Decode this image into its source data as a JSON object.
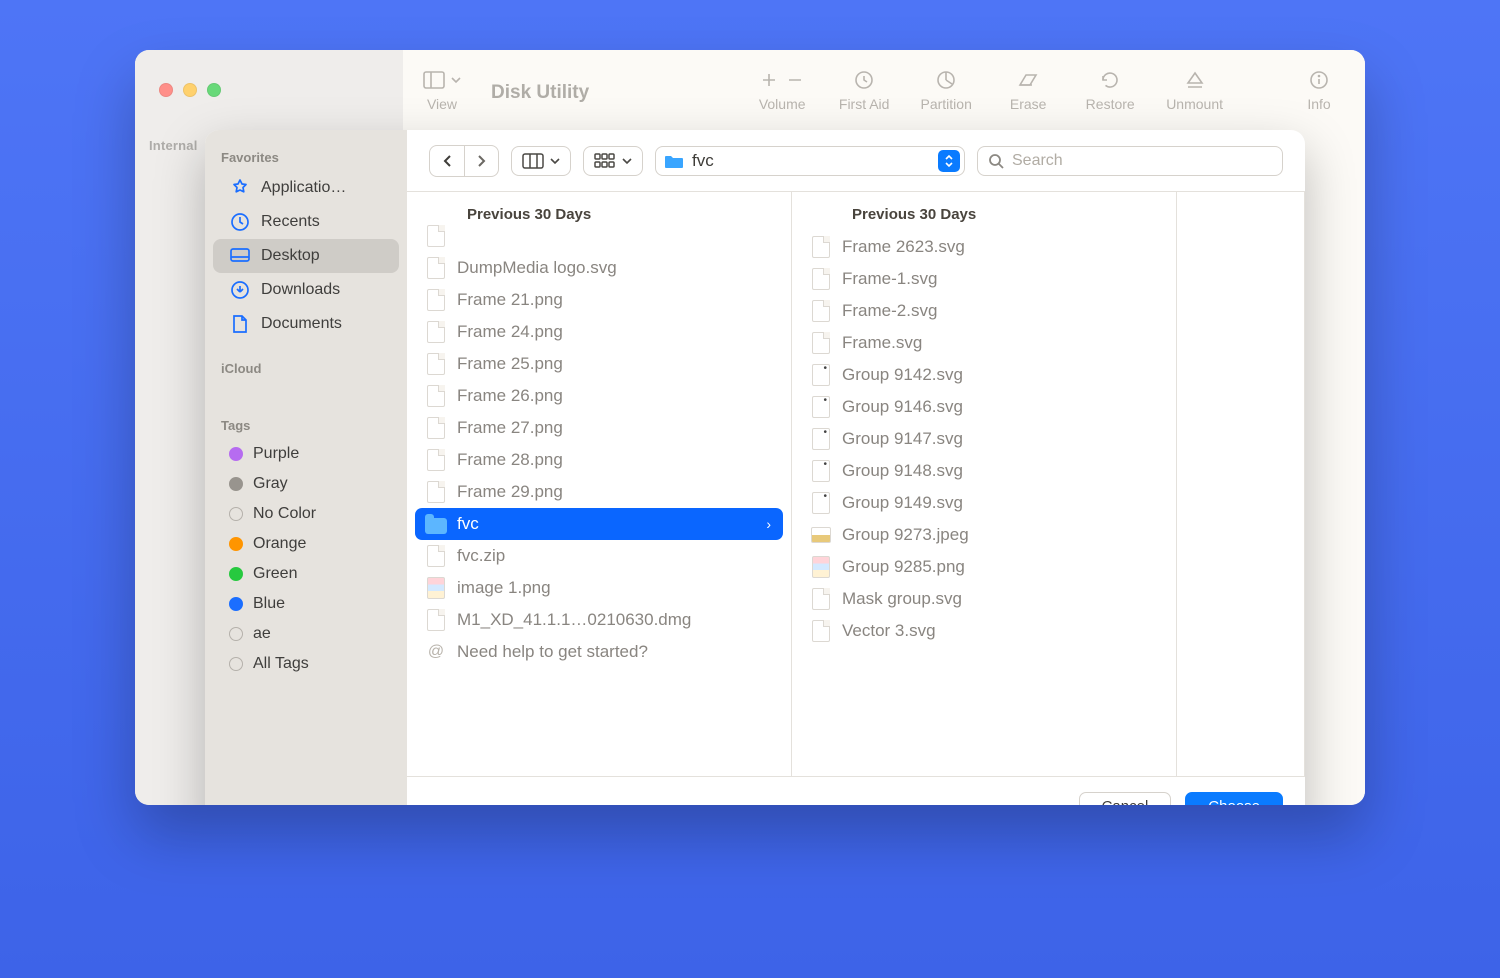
{
  "app": {
    "title": "Disk Utility",
    "toolbar": {
      "view": "View",
      "volume": "Volume",
      "firstAid": "First Aid",
      "partition": "Partition",
      "erase": "Erase",
      "restore": "Restore",
      "unmount": "Unmount",
      "info": "Info"
    },
    "sidebar": {
      "internal": "Internal"
    }
  },
  "dialog": {
    "sidebar": {
      "favoritesHeading": "Favorites",
      "icloudHeading": "iCloud",
      "tagsHeading": "Tags",
      "favorites": [
        {
          "id": "applications",
          "label": "Applicatio…",
          "icon": "appstore"
        },
        {
          "id": "recents",
          "label": "Recents",
          "icon": "clock"
        },
        {
          "id": "desktop",
          "label": "Desktop",
          "icon": "desktop",
          "selected": true
        },
        {
          "id": "downloads",
          "label": "Downloads",
          "icon": "download"
        },
        {
          "id": "documents",
          "label": "Documents",
          "icon": "document"
        }
      ],
      "tags": [
        {
          "label": "Purple",
          "class": "tag-purple"
        },
        {
          "label": "Gray",
          "class": "tag-gray"
        },
        {
          "label": "No Color",
          "class": "tag-hollow"
        },
        {
          "label": "Orange",
          "class": "tag-orange"
        },
        {
          "label": "Green",
          "class": "tag-green"
        },
        {
          "label": "Blue",
          "class": "tag-blue"
        },
        {
          "label": "ae",
          "class": "tag-hollow"
        },
        {
          "label": "All Tags",
          "class": "tag-hollow"
        }
      ]
    },
    "toolbar": {
      "currentFolder": "fvc",
      "searchPlaceholder": "Search"
    },
    "column1": {
      "heading": "Previous 30 Days",
      "items": [
        {
          "name": "DumpMedia logo.svg",
          "type": "generic"
        },
        {
          "name": "Frame 21.png",
          "type": "generic"
        },
        {
          "name": "Frame 24.png",
          "type": "generic"
        },
        {
          "name": "Frame 25.png",
          "type": "generic"
        },
        {
          "name": "Frame 26.png",
          "type": "generic"
        },
        {
          "name": "Frame 27.png",
          "type": "generic"
        },
        {
          "name": "Frame 28.png",
          "type": "generic"
        },
        {
          "name": "Frame 29.png",
          "type": "generic"
        },
        {
          "name": "fvc",
          "type": "folder",
          "selected": true
        },
        {
          "name": "fvc.zip",
          "type": "generic"
        },
        {
          "name": "image 1.png",
          "type": "color"
        },
        {
          "name": "M1_XD_41.1.1…0210630.dmg",
          "type": "generic"
        },
        {
          "name": "Need help to get started?",
          "type": "at"
        }
      ]
    },
    "column2": {
      "heading": "Previous 30 Days",
      "items": [
        {
          "name": "Frame 2623.svg",
          "type": "generic"
        },
        {
          "name": "Frame-1.svg",
          "type": "generic"
        },
        {
          "name": "Frame-2.svg",
          "type": "generic"
        },
        {
          "name": "Frame.svg",
          "type": "generic"
        },
        {
          "name": "Group 9142.svg",
          "type": "dot"
        },
        {
          "name": "Group 9146.svg",
          "type": "dot"
        },
        {
          "name": "Group 9147.svg",
          "type": "dot"
        },
        {
          "name": "Group 9148.svg",
          "type": "dot"
        },
        {
          "name": "Group 9149.svg",
          "type": "dot"
        },
        {
          "name": "Group 9273.jpeg",
          "type": "img"
        },
        {
          "name": "Group 9285.png",
          "type": "color"
        },
        {
          "name": "Mask group.svg",
          "type": "generic"
        },
        {
          "name": "Vector 3.svg",
          "type": "generic"
        }
      ]
    },
    "footer": {
      "cancel": "Cancel",
      "choose": "Choose"
    }
  }
}
